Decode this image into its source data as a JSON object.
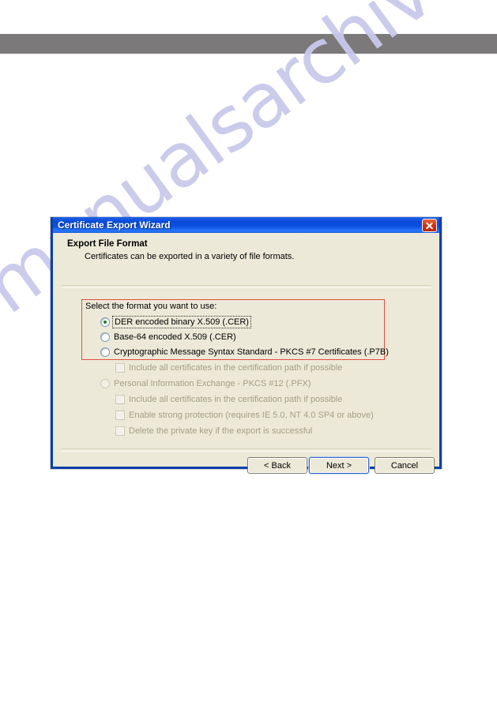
{
  "page": {
    "watermark_text": "manualsarchive.com",
    "banner_color": "#7b7979",
    "background_color": "#ffffff"
  },
  "dialog": {
    "title": "Certificate Export Wizard",
    "close_icon": "close-icon",
    "titlebar_color": "#0a4ad8",
    "body_color": "#ece9d8",
    "header": {
      "title": "Export File Format",
      "subtitle": "Certificates can be exported in a variety of file formats."
    },
    "highlight_color": "#e2523f",
    "prompt": "Select the format you want to use:",
    "format_options": [
      {
        "label": "DER encoded binary X.509 (.CER)",
        "selected": true,
        "enabled": true,
        "focused": true
      },
      {
        "label": "Base-64 encoded X.509 (.CER)",
        "selected": false,
        "enabled": true,
        "focused": false
      },
      {
        "label": "Cryptographic Message Syntax Standard - PKCS #7 Certificates (.P7B)",
        "selected": false,
        "enabled": true,
        "focused": false
      }
    ],
    "p7b_suboption": {
      "label": "Include all certificates in the certification path if possible",
      "checked": false,
      "enabled": false
    },
    "pfx_option": {
      "label": "Personal Information Exchange - PKCS #12 (.PFX)",
      "selected": false,
      "enabled": false
    },
    "pfx_suboptions": [
      {
        "label": "Include all certificates in the certification path if possible",
        "checked": false,
        "enabled": false
      },
      {
        "label": "Enable strong protection (requires IE 5.0, NT 4.0 SP4 or above)",
        "checked": false,
        "enabled": false
      },
      {
        "label": "Delete the private key if the export is successful",
        "checked": false,
        "enabled": false
      }
    ],
    "buttons": {
      "back": "< Back",
      "next": "Next >",
      "cancel": "Cancel",
      "default_button": "next"
    }
  }
}
